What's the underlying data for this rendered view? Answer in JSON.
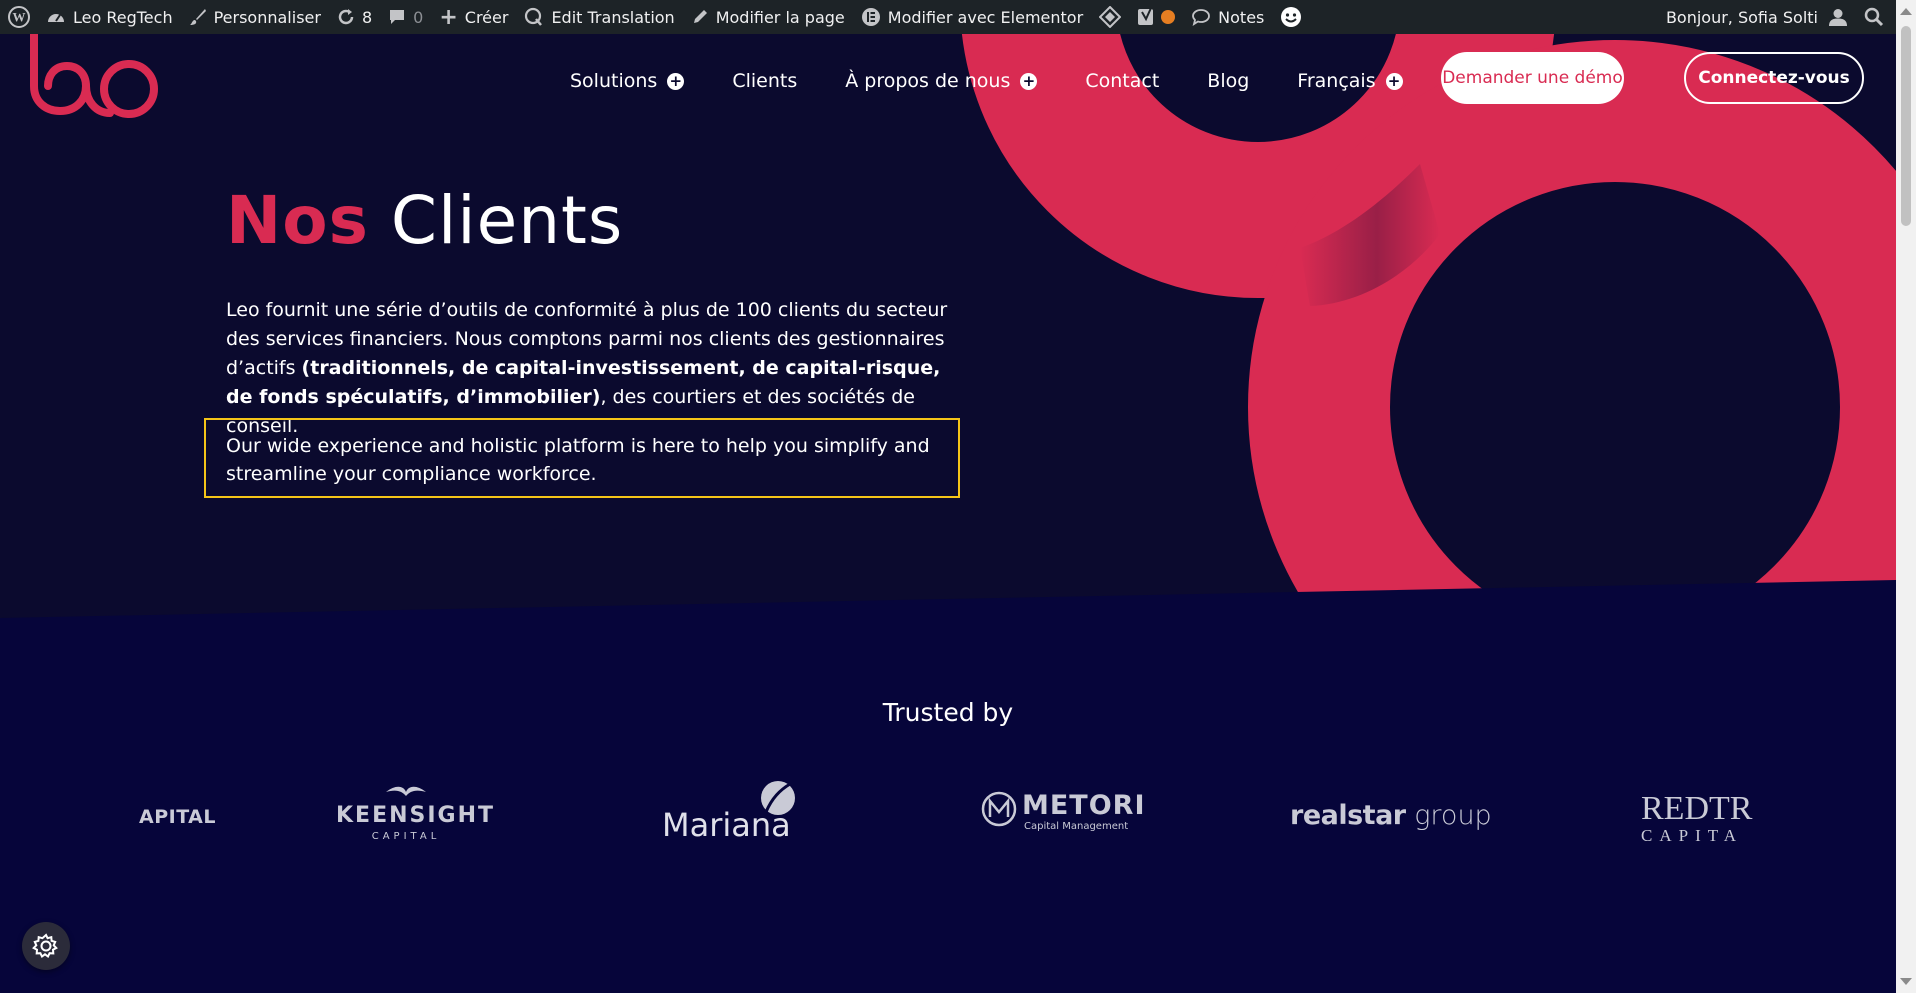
{
  "admin_bar": {
    "site_name": "Leo RegTech",
    "customize": "Personnaliser",
    "updates_count": "8",
    "comments_count": "0",
    "new": "Créer",
    "edit_translation": "Edit Translation",
    "edit_page": "Modifier la page",
    "edit_elementor": "Modifier avec Elementor",
    "notes": "Notes",
    "greeting": "Bonjour, Sofia Solti"
  },
  "nav": {
    "items": [
      {
        "label": "Solutions",
        "has_submenu": true
      },
      {
        "label": "Clients",
        "has_submenu": false
      },
      {
        "label": "À propos de nous",
        "has_submenu": true
      },
      {
        "label": "Contact",
        "has_submenu": false
      },
      {
        "label": "Blog",
        "has_submenu": false
      },
      {
        "label": "Français",
        "has_submenu": true
      }
    ],
    "demo_button": "Demander une démo",
    "login_button": "Connectez-vous"
  },
  "hero": {
    "title_accent": "Nos",
    "title_rest": "Clients",
    "intro_before": "Leo fournit une série d’outils de conformité à plus de 100 clients du secteur des services financiers. Nous comptons parmi nos clients des gestionnaires d’actifs ",
    "intro_bold": "(traditionnels, de capital-investissement, de capital-risque, de fonds spéculatifs, d’immobilier)",
    "intro_after": ", des courtiers et des sociétés de conseil.",
    "highlight_text": "Our wide experience and holistic platform is here to help you simplify and streamline your compliance workforce."
  },
  "trusted": {
    "title": "Trusted by",
    "logos": {
      "partial_left": "APITAL",
      "keensight_main": "KEENSIGHT",
      "keensight_sub": "CAPITAL",
      "mariana": "Mariana",
      "metori_main": "METORI",
      "metori_sub": "Capital Management",
      "realstar_a": "realstar",
      "realstar_b": "group",
      "redtree_main": "REDTREE",
      "redtree_sub": "CAPITA"
    }
  },
  "colors": {
    "brand_red": "#d92b52",
    "hero_bg": "#0b0a2e",
    "trusted_bg": "#06053a",
    "highlight_border": "#f5c518",
    "admin_bar": "#1d2327"
  }
}
